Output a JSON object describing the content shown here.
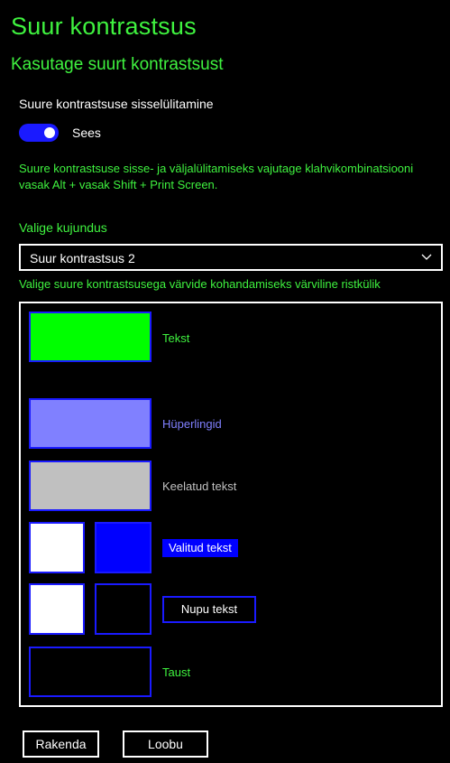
{
  "page": {
    "title": "Suur kontrastsus",
    "subtitle": "Kasutage suurt kontrastsust"
  },
  "toggle": {
    "label": "Suure kontrastsuse sisselülitamine",
    "state": "Sees",
    "on": true
  },
  "help_text": "Suure kontrastsuse sisse- ja väljalülitamiseks vajutage klahvikombinatsiooni vasak Alt + vasak Shift + Print Screen.",
  "theme": {
    "label": "Valige kujundus",
    "selected": "Suur kontrastsus 2"
  },
  "swatches": {
    "label": "Valige suure kontrastsusega värvide kohandamiseks värviline ristkülik",
    "items": [
      {
        "label": "Tekst",
        "color": "#00ff00",
        "label_color": "#3ff23f"
      },
      {
        "label": "Hüperlingid",
        "color": "#8080ff",
        "label_color": "#8080ff"
      },
      {
        "label": "Keelatud tekst",
        "color": "#c0c0c0",
        "label_color": "#c0c0c0"
      },
      {
        "label": "Valitud tekst",
        "fg": "#ffffff",
        "bg": "#0000ff"
      },
      {
        "label": "Nupu tekst",
        "fg": "#ffffff",
        "bg": "#000000"
      },
      {
        "label": "Taust",
        "color": "#000000",
        "label_color": "#3ff23f"
      }
    ]
  },
  "buttons": {
    "apply": "Rakenda",
    "cancel": "Loobu"
  },
  "colors": {
    "accent": "#3ff23f",
    "toggle": "#1a1aff",
    "swatch_border": "#1a1aff"
  }
}
